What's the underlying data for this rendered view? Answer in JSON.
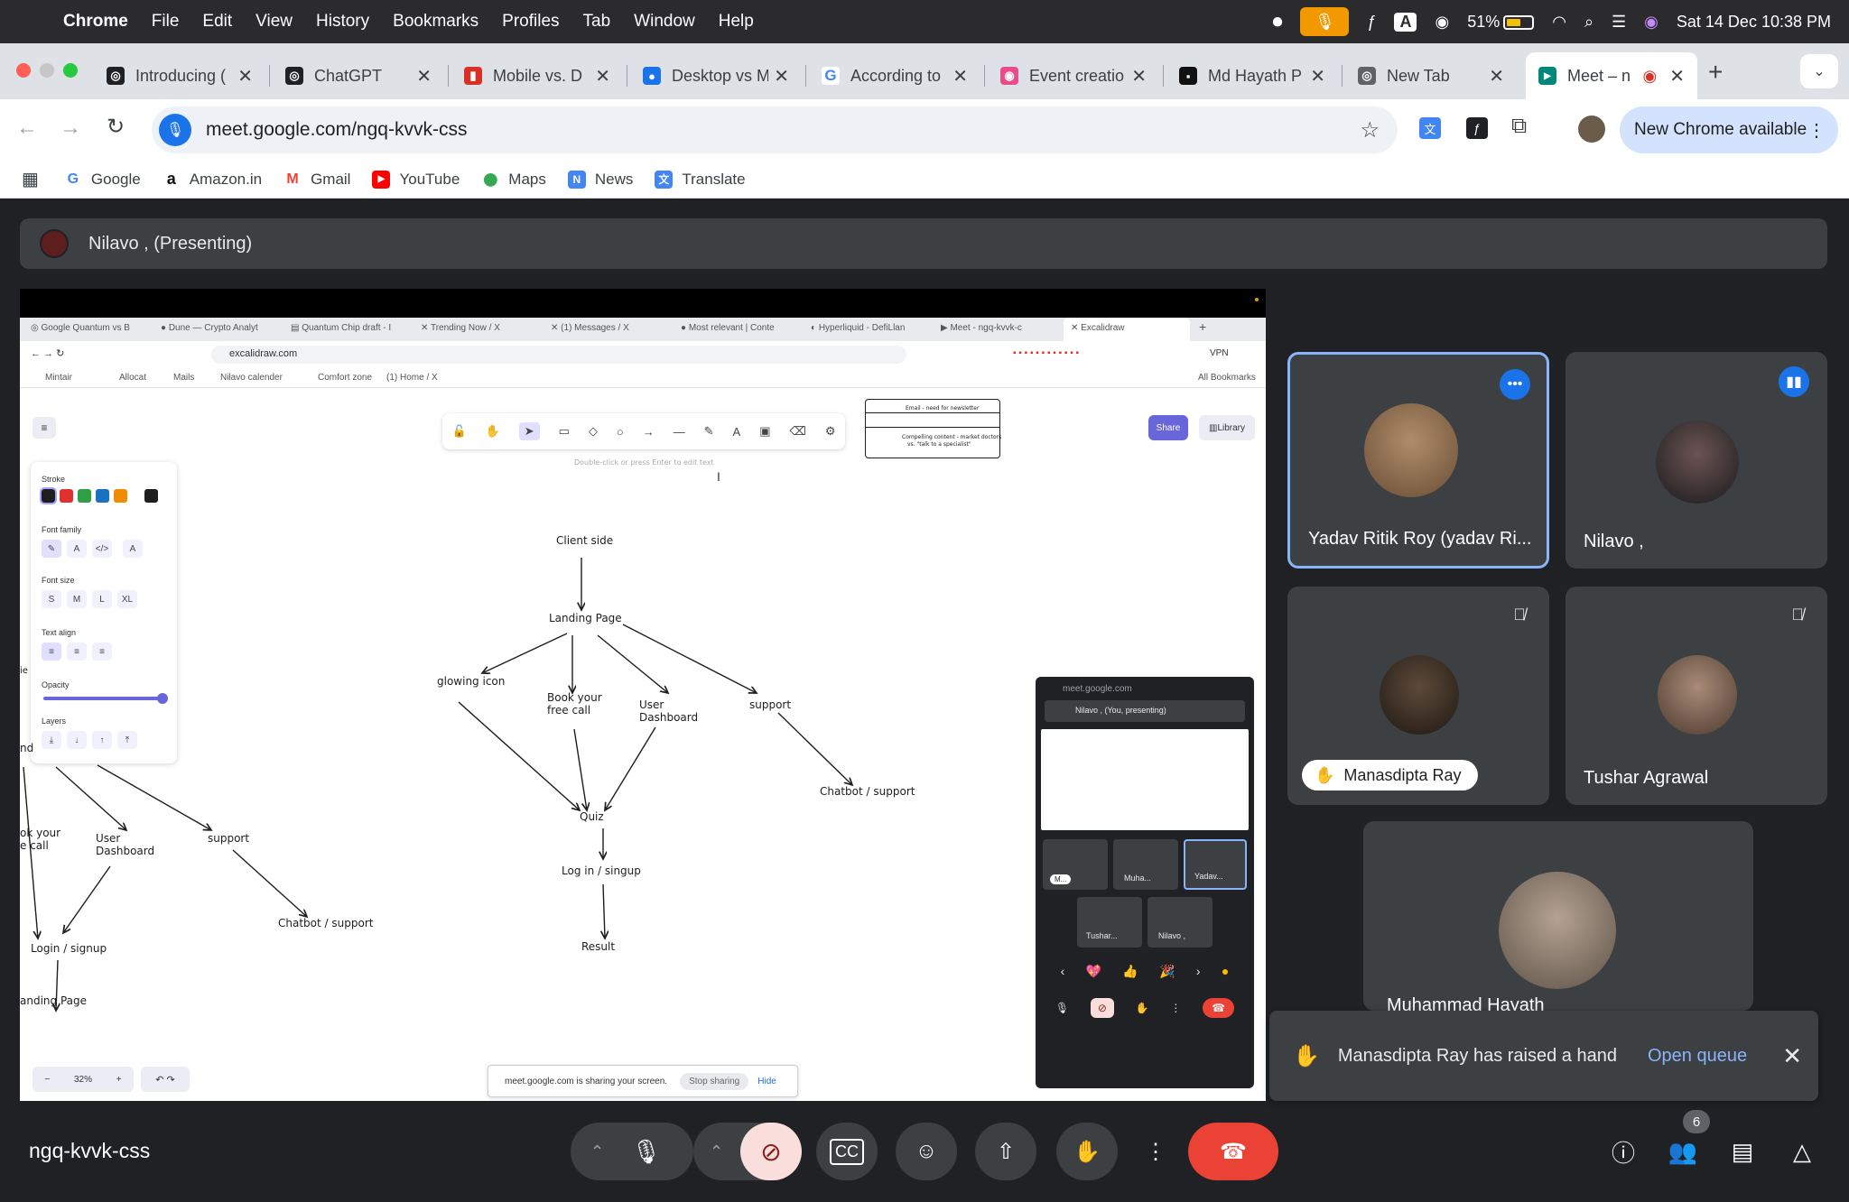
{
  "menubar": {
    "app": "Chrome",
    "items": [
      "File",
      "Edit",
      "View",
      "History",
      "Bookmarks",
      "Profiles",
      "Tab",
      "Window",
      "Help"
    ],
    "battery": "51%",
    "clock": "Sat 14 Dec  10:38 PM"
  },
  "tabs": [
    {
      "title": "Introducing (",
      "fav_color": "#202124",
      "fav_glyph": "◎"
    },
    {
      "title": "ChatGPT",
      "fav_color": "#202124",
      "fav_glyph": "◎"
    },
    {
      "title": "Mobile vs. D",
      "fav_color": "#d93025",
      "fav_glyph": "▮"
    },
    {
      "title": "Desktop vs M",
      "fav_color": "#1a73e8",
      "fav_glyph": "●"
    },
    {
      "title": "According to",
      "fav_color": "#ffffff",
      "fav_glyph": "G"
    },
    {
      "title": "Event creatio",
      "fav_color": "#ea4c89",
      "fav_glyph": "◉"
    },
    {
      "title": "Md Hayath P",
      "fav_color": "#111111",
      "fav_glyph": "▪"
    },
    {
      "title": "New Tab",
      "fav_color": "#5f6368",
      "fav_glyph": "◎"
    },
    {
      "title": "Meet – n",
      "fav_color": "#00897b",
      "fav_glyph": "▶"
    }
  ],
  "address": {
    "url": "meet.google.com/ngq-kvvk-css",
    "update_label": "New Chrome available"
  },
  "bookmarks": [
    {
      "label": "Google",
      "color": "#4285f4",
      "glyph": "G"
    },
    {
      "label": "Amazon.in",
      "color": "#111111",
      "glyph": "a"
    },
    {
      "label": "Gmail",
      "color": "#ea4335",
      "glyph": "M"
    },
    {
      "label": "YouTube",
      "color": "#ff0000",
      "glyph": "▶"
    },
    {
      "label": "Maps",
      "color": "#34a853",
      "glyph": "⬤"
    },
    {
      "label": "News",
      "color": "#4285f4",
      "glyph": "N"
    },
    {
      "label": "Translate",
      "color": "#4285f4",
      "glyph": "文"
    }
  ],
  "presenting": {
    "label": "Nilavo , (Presenting)"
  },
  "shared_screen": {
    "tabs": [
      "Google Quantum vs B",
      "Dune — Crypto Analyt",
      "Quantum Chip draft - I",
      "Trending Now / X",
      "(1) Messages / X",
      "Most relevant | Conte",
      "Hyperliquid - DefiLlan",
      "Meet - ngq-kvvk-c",
      "Excalidraw"
    ],
    "url": "excalidraw.com",
    "vpn": "VPN",
    "bookmarks": [
      "Mintair",
      "Allocat",
      "Mails",
      "Nilavo calender",
      "Comfort zone",
      "(1) Home / X"
    ],
    "all_bookmarks": "All Bookmarks",
    "hint": "Double-click or press Enter to edit text",
    "share": "Share",
    "library": "Library",
    "panel": {
      "stroke": "Stroke",
      "font_family": "Font family",
      "font_size": "Font size",
      "text_align": "Text align",
      "opacity": "Opacity",
      "layers": "Layers",
      "sizes": [
        "S",
        "M",
        "L",
        "XL"
      ],
      "stroke_colors": [
        "#1e1e1e",
        "#e03131",
        "#2f9e44",
        "#1971c2",
        "#f08c00"
      ]
    },
    "diagram_nodes": {
      "client_side": "Client side",
      "landing_page": "Landing Page",
      "glowing_icon": "glowing icon",
      "book_call_1": "Book your",
      "book_call_2": "free call",
      "user_dash_1": "User",
      "user_dash_2": "Dashboard",
      "support": "support",
      "chatbot": "Chatbot / support",
      "quiz": "Quiz",
      "login": "Log in / singup",
      "result": "Result"
    },
    "left_diagram": {
      "book_1": "ok your",
      "book_2": "e call",
      "user_1": "User",
      "user_2": "Dashboard",
      "support": "support",
      "chatbot": "Chatbot / support",
      "login": "Login / signup",
      "landing": "anding Page",
      "partial_1": "ie",
      "partial_2": "nd"
    },
    "card_text": {
      "line1": "Email - need for newsletter",
      "line2": "Compelling content - market doctors",
      "line3": "vs. \"talk to a specialist\""
    },
    "zoom": "32%",
    "sharing_notice": "meet.google.com is sharing your screen.",
    "stop_sharing": "Stop sharing",
    "hide": "Hide",
    "mini_meet": {
      "url": "meet.google.com",
      "presenting": "Nilavo , (You, presenting)",
      "tiles": [
        "M...",
        "Muha...",
        "Yadav...",
        "Tushar...",
        "Nilavo ,"
      ]
    }
  },
  "participants": [
    {
      "name": "Yadav Ritik Roy (yadav Ri...",
      "status": "more"
    },
    {
      "name": "Nilavo ,",
      "status": "speaking"
    },
    {
      "name": "Manasdipta Ray",
      "status": "muted",
      "hand": true
    },
    {
      "name": "Tushar Agrawal",
      "status": "muted"
    },
    {
      "name": "Muhammad Hayath",
      "status": ""
    }
  ],
  "toast": {
    "message": "Manasdipta Ray has raised a hand",
    "action": "Open queue"
  },
  "bottom": {
    "meeting_code": "ngq-kvvk-css",
    "people_count": "6"
  },
  "colors": {
    "accent": "#8ab4f8",
    "end_call": "#ea4335",
    "cam_off": "#f9dedc"
  }
}
